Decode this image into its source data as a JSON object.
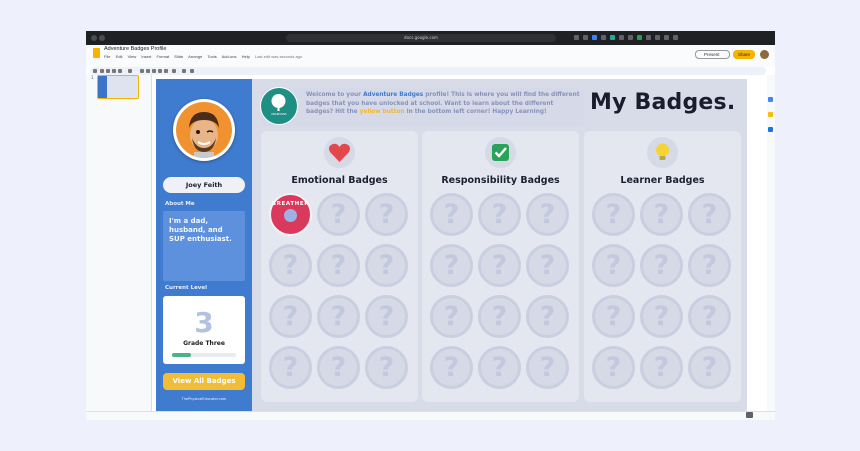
{
  "browser": {
    "url": "docs.google.com"
  },
  "app": {
    "doc_title": "Adventure Badges Profile",
    "menu": [
      "File",
      "Edit",
      "View",
      "Insert",
      "Format",
      "Slide",
      "Arrange",
      "Tools",
      "Add-ons",
      "Help"
    ],
    "last_edit": "Last edit was seconds ago",
    "present_label": "Present",
    "share_label": "Share",
    "slide_number": "1"
  },
  "sidebar": {
    "name": "Joey Feith",
    "about_heading": "About Me",
    "about_text": "I'm a dad, husband, and SUP enthusiast.",
    "level_heading": "Current Level",
    "level_number": "3",
    "level_name": "Grade Three",
    "level_progress": 0.3,
    "view_all_label": "View All Badges",
    "footer": "ThePhysicalEducator.com"
  },
  "main": {
    "welcome_pre": "Welcome to your ",
    "welcome_link": "Adventure Badges",
    "welcome_mid": " profile! This is where you will find the different badges that you have unlocked at school. Want to learn about the different badges? Hit the ",
    "welcome_button": "yellow button",
    "welcome_post": " in the bottom left corner! Happy Learning!",
    "title": "My Badges.",
    "school_logo_text": "MOUNTAINS"
  },
  "panels": [
    {
      "title": "Emotional Badges",
      "icon": "heart-icon",
      "icon_color": "#e2474b",
      "earned": [
        {
          "label": "BREATHER"
        }
      ]
    },
    {
      "title": "Responsibility Badges",
      "icon": "checkmark-icon",
      "icon_color": "#29a35a",
      "earned": []
    },
    {
      "title": "Learner Badges",
      "icon": "lightbulb-icon",
      "icon_color": "#f5d435",
      "earned": []
    }
  ],
  "colors": {
    "sidebar_blue": "#3f7bcf",
    "accent_yellow": "#f2bd36",
    "badge_red": "#d9395c"
  },
  "locked_badge_glyph": "?"
}
